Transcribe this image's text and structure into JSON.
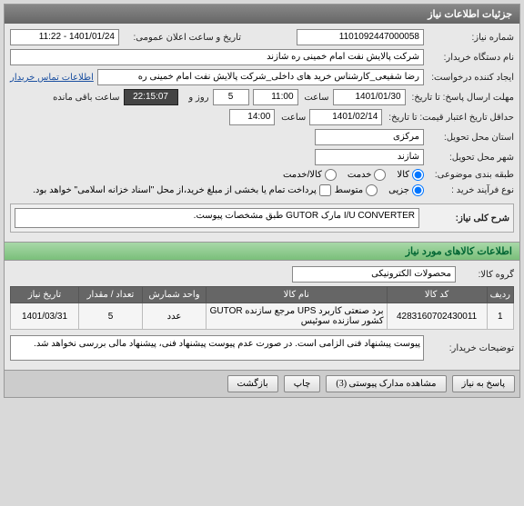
{
  "panel_title": "جزئیات اطلاعات نیاز",
  "fields": {
    "need_no_lbl": "شماره نیاز:",
    "need_no": "1101092447000058",
    "announce_lbl": "تاریخ و ساعت اعلان عمومی:",
    "announce": "1401/01/24 - 11:22",
    "buyer_lbl": "نام دستگاه خریدار:",
    "buyer": "شرکت پالایش نفت امام خمینی  ره  شازند",
    "creator_lbl": "ایجاد کننده درخواست:",
    "creator": "رضا  شفیعی_کارشناس خرید های داخلی_شرکت پالایش نفت امام خمینی  ره",
    "contact_link": "اطلاعات تماس خریدار",
    "deadline_lbl": "مهلت ارسال پاسخ: تا تاریخ:",
    "deadline_date": "1401/01/30",
    "deadline_time_lbl": "ساعت",
    "deadline_time": "11:00",
    "days": "5",
    "days_lbl": "روز و",
    "remain_time": "22:15:07",
    "remain_lbl": "ساعت باقی مانده",
    "validity_lbl": "حداقل تاریخ اعتبار قیمت: تا تاریخ:",
    "validity_date": "1401/02/14",
    "validity_time_lbl": "ساعت",
    "validity_time": "14:00",
    "province_lbl": "استان محل تحویل:",
    "province": "مرکزی",
    "city_lbl": "شهر محل تحویل:",
    "city": "شازند",
    "class_lbl": "طبقه بندی موضوعی:",
    "class_goods": "کالا",
    "class_service": "خدمت",
    "class_goods_service": "کالا/خدمت",
    "buy_type_lbl": "نوع فرآیند خرید :",
    "buy_type_partial": "جزیی",
    "buy_type_mid": "متوسط",
    "buy_note": "پرداخت تمام یا بخشی از مبلغ خرید،از محل \"اسناد خزانه اسلامی\" خواهد بود.",
    "summary_lbl": "شرح کلی نیاز:",
    "summary": "I/U CONVERTER مارک GUTOR طبق مشخصات پیوست.",
    "items_header": "اطلاعات کالاهای مورد نیاز",
    "group_lbl": "گروه کالا:",
    "group": "محصولات الکترونیکی",
    "desc_lbl": "توضیحات خریدار:",
    "desc": "پیوست پیشنهاد فنی الزامی است. در صورت عدم پیوست پیشنهاد فنی، پیشنهاد مالی بررسی نخواهد شد."
  },
  "table": {
    "headers": [
      "ردیف",
      "کد کالا",
      "نام کالا",
      "واحد شمارش",
      "تعداد / مقدار",
      "تاریخ نیاز"
    ],
    "rows": [
      {
        "idx": "1",
        "code": "4283160702430011",
        "name": "برد صنعتی کاربرد UPS مرجع سازنده GUTOR کشور سازنده سوئیس",
        "unit": "عدد",
        "qty": "5",
        "date": "1401/03/31"
      }
    ]
  },
  "buttons": {
    "reply": "پاسخ به نیاز",
    "attachments": "مشاهده مدارک پیوستی (3)",
    "print": "چاپ",
    "back": "بازگشت"
  }
}
